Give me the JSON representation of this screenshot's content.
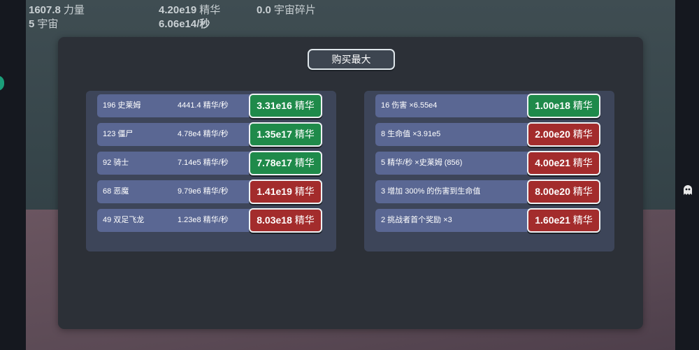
{
  "stats": {
    "power": {
      "value": "1607.8",
      "unit": "力量"
    },
    "essence": {
      "value": "4.20e19",
      "unit": "精华"
    },
    "fragments": {
      "value": "0.0",
      "unit": "宇宙碎片"
    },
    "universes": {
      "value": "5",
      "unit": "宇宙"
    },
    "essence_rate": {
      "value": "6.06e14/秒"
    }
  },
  "modal": {
    "buy_max_label": "购买最大",
    "colors": {
      "affordable": "#1f8a4a",
      "unaffordable": "#a32c2c",
      "row": "#5a6793"
    },
    "units": [
      {
        "level": "196 史莱姆",
        "rate": "4441.4 精华/秒",
        "cost": "3.31e16",
        "currency": "精华",
        "affordable": true
      },
      {
        "level": "123 僵尸",
        "rate": "4.78e4 精华/秒",
        "cost": "1.35e17",
        "currency": "精华",
        "affordable": true
      },
      {
        "level": "92 骑士",
        "rate": "7.14e5 精华/秒",
        "cost": "7.78e17",
        "currency": "精华",
        "affordable": true
      },
      {
        "level": "68 恶魔",
        "rate": "9.79e6 精华/秒",
        "cost": "1.41e19",
        "currency": "精华",
        "affordable": false
      },
      {
        "level": "49 双足飞龙",
        "rate": "1.23e8 精华/秒",
        "cost": "8.03e18",
        "currency": "精华",
        "affordable": false
      }
    ],
    "upgrades": [
      {
        "label": "16 伤害 ×6.55e4",
        "cost": "1.00e18",
        "currency": "精华",
        "affordable": true
      },
      {
        "label": "8 生命值 ×3.91e5",
        "cost": "2.00e20",
        "currency": "精华",
        "affordable": false
      },
      {
        "label": "5 精华/秒 ×史莱姆 (856)",
        "cost": "4.00e21",
        "currency": "精华",
        "affordable": false
      },
      {
        "label": "3 增加 300% 的伤害到生命值",
        "cost": "8.00e20",
        "currency": "精华",
        "affordable": false
      },
      {
        "label": "2 挑战者首个奖励 ×3",
        "cost": "1.60e21",
        "currency": "精华",
        "affordable": false
      }
    ]
  }
}
